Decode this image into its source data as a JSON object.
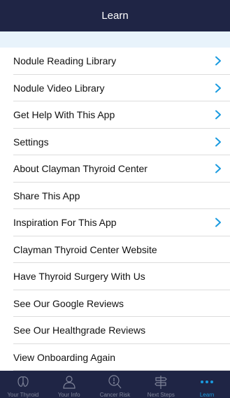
{
  "header": {
    "title": "Learn"
  },
  "menu": [
    {
      "label": "Nodule Reading Library",
      "chevron": true
    },
    {
      "label": "Nodule Video Library",
      "chevron": true
    },
    {
      "label": "Get Help With This App",
      "chevron": true
    },
    {
      "label": "Settings",
      "chevron": true
    },
    {
      "label": "About Clayman Thyroid Center",
      "chevron": true
    },
    {
      "label": "Share This App",
      "chevron": false
    },
    {
      "label": "Inspiration For This App",
      "chevron": true
    },
    {
      "label": "Clayman Thyroid Center Website",
      "chevron": false
    },
    {
      "label": "Have Thyroid Surgery With Us",
      "chevron": false
    },
    {
      "label": "See Our Google Reviews",
      "chevron": false
    },
    {
      "label": "See Our Healthgrade Reviews",
      "chevron": false
    },
    {
      "label": "View Onboarding Again",
      "chevron": false
    }
  ],
  "tabs": [
    {
      "label": "Your Thyroid",
      "icon": "thyroid-icon"
    },
    {
      "label": "Your Info",
      "icon": "person-icon"
    },
    {
      "label": "Cancer Risk",
      "icon": "search-alert-icon"
    },
    {
      "label": "Next Steps",
      "icon": "signpost-icon"
    },
    {
      "label": "Learn",
      "icon": "more-dots-icon",
      "active": true
    }
  ],
  "colors": {
    "header_bg": "#1f2545",
    "accent": "#1a9be0",
    "tab_inactive": "#7f8499",
    "spacer_bg": "#e8f3fb"
  }
}
